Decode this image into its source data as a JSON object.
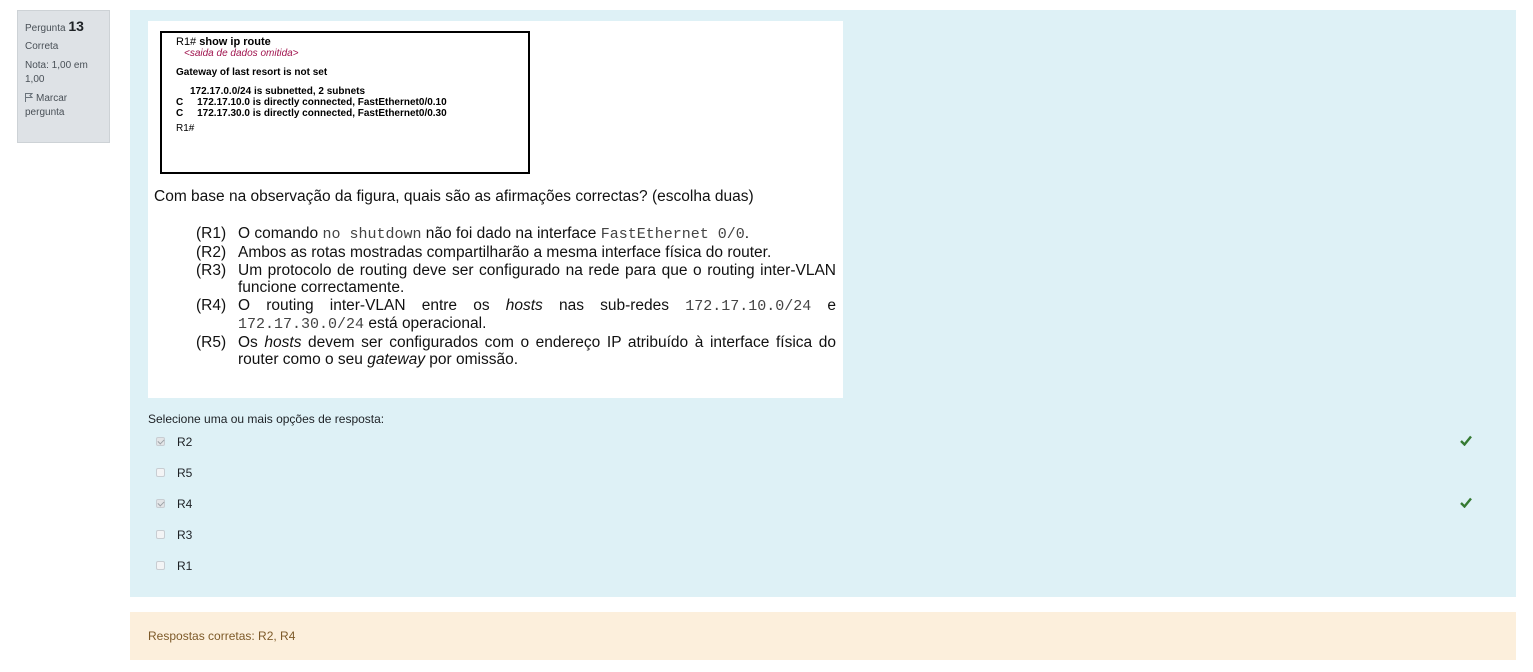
{
  "info": {
    "question_label": "Pergunta",
    "question_number": "13",
    "state": "Correta",
    "grade": "Nota: 1,00 em 1,00",
    "flag_label": "Marcar pergunta"
  },
  "figure": {
    "prompt_prefix": "R1# ",
    "command": "show ip route",
    "omitted": "<saida de dados omitida>",
    "gateway_line": "Gateway of last resort is not set",
    "subnet_line": "172.17.0.0/24 is subnetted, 2 subnets",
    "route1": "C     172.17.10.0 is directly connected, FastEthernet0/0.10",
    "route2": "C     172.17.30.0 is directly connected, FastEthernet0/0.30",
    "end_prompt": "R1#"
  },
  "question": {
    "text": "Com base na observação da figura, quais são as afirmações correctas? (escolha duas)",
    "statements": [
      {
        "label": "(R1)",
        "parts": [
          "O comando ",
          "no shutdown",
          " não foi dado na interface ",
          "FastEthernet 0/0",
          "."
        ]
      },
      {
        "label": "(R2)",
        "text": "Ambos as rotas mostradas compartilharão a mesma interface física do router."
      },
      {
        "label": "(R3)",
        "text": "Um protocolo de routing deve ser configurado na rede para que o routing inter-VLAN funcione correctamente."
      },
      {
        "label": "(R4)",
        "parts": [
          "O routing inter-VLAN entre os ",
          "hosts",
          " nas sub-redes ",
          "172.17.10.0/24",
          " e ",
          "172.17.30.0/24",
          " está operacional."
        ]
      },
      {
        "label": "(R5)",
        "parts": [
          "Os ",
          "hosts",
          " devem ser configurados com o endereço IP atribuído à interface física do router como o seu ",
          "gateway",
          " por omissão."
        ]
      }
    ]
  },
  "answer_prompt": "Selecione uma ou mais opções de resposta:",
  "answers": [
    {
      "label": "R2",
      "checked": true,
      "correct": true
    },
    {
      "label": "R5",
      "checked": false,
      "correct": false
    },
    {
      "label": "R4",
      "checked": true,
      "correct": true
    },
    {
      "label": "R3",
      "checked": false,
      "correct": false
    },
    {
      "label": "R1",
      "checked": false,
      "correct": false
    }
  ],
  "feedback": "Respostas corretas: R2, R4",
  "colors": {
    "content_bg": "#def1f6",
    "feedback_bg": "#fcefdc",
    "tick": "#357a32"
  }
}
